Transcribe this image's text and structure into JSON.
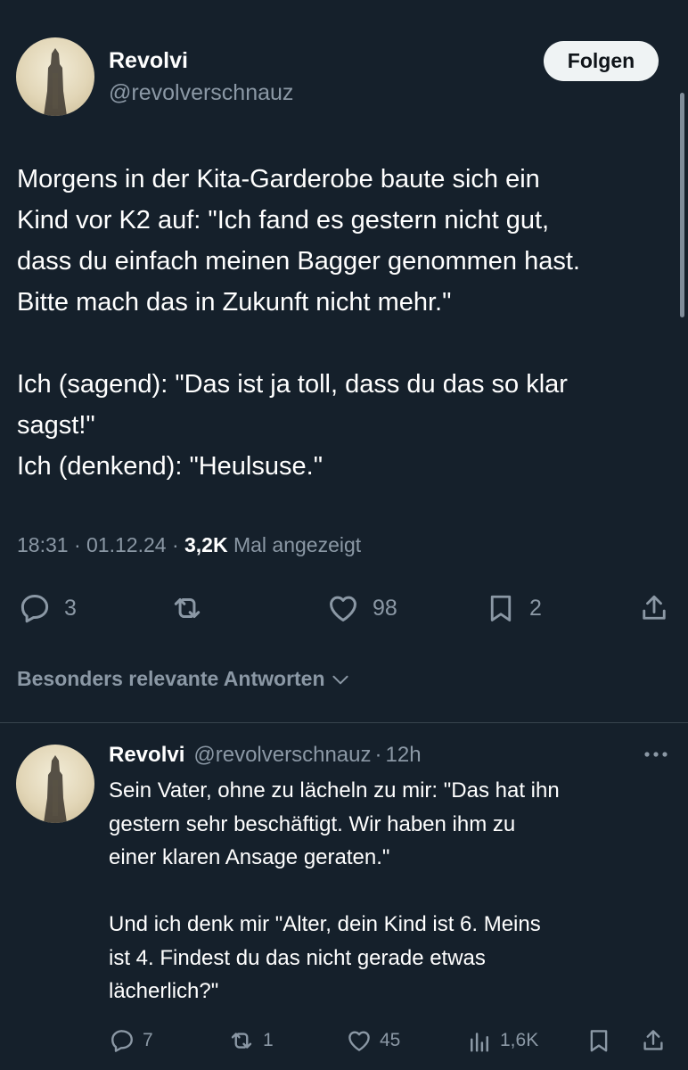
{
  "tweet": {
    "author_name": "Revolvi",
    "author_handle": "@revolverschnauz",
    "follow_label": "Folgen",
    "text": "Morgens in der Kita-Garderobe baute sich ein\nKind vor K2 auf: \"Ich fand es gestern nicht gut,\ndass du einfach meinen Bagger genommen hast.\nBitte mach das in Zukunft nicht mehr.\"\n\nIch (sagend): \"Das ist ja toll, dass du das so klar\nsagst!\"\nIch (denkend): \"Heulsuse.\"",
    "time": "18:31",
    "date": "01.12.24",
    "views_count": "3,2K",
    "views_label": "Mal angezeigt",
    "separator": "·",
    "actions": {
      "reply_count": "3",
      "retweet_count": "",
      "like_count": "98",
      "bookmark_count": "2"
    },
    "icons": [
      "reply-icon",
      "retweet-icon",
      "like-icon",
      "bookmark-icon",
      "share-icon"
    ]
  },
  "replies_filter": {
    "label": "Besonders relevante Antworten",
    "icon": "chevron-down-icon"
  },
  "reply": {
    "author_name": "Revolvi",
    "author_handle": "@revolverschnauz",
    "separator": "·",
    "time_ago": "12h",
    "text": "Sein Vater, ohne zu lächeln zu mir: \"Das hat ihn\ngestern sehr beschäftigt. Wir haben ihm zu\neiner klaren Ansage geraten.\"\n\nUnd ich denk mir \"Alter, dein Kind ist 6. Meins\nist 4. Findest du das nicht gerade etwas\nlächerlich?\"",
    "actions": {
      "reply_count": "7",
      "retweet_count": "1",
      "like_count": "45",
      "views_count": "1,6K"
    },
    "icons": [
      "more-icon",
      "reply-icon",
      "retweet-icon",
      "like-icon",
      "analytics-icon",
      "bookmark-icon",
      "share-icon"
    ]
  },
  "colors": {
    "background": "#15202b",
    "text_primary": "#ffffff",
    "text_secondary": "#8b98a5",
    "divider": "#38444d",
    "follow_button_bg": "#eff3f4"
  }
}
